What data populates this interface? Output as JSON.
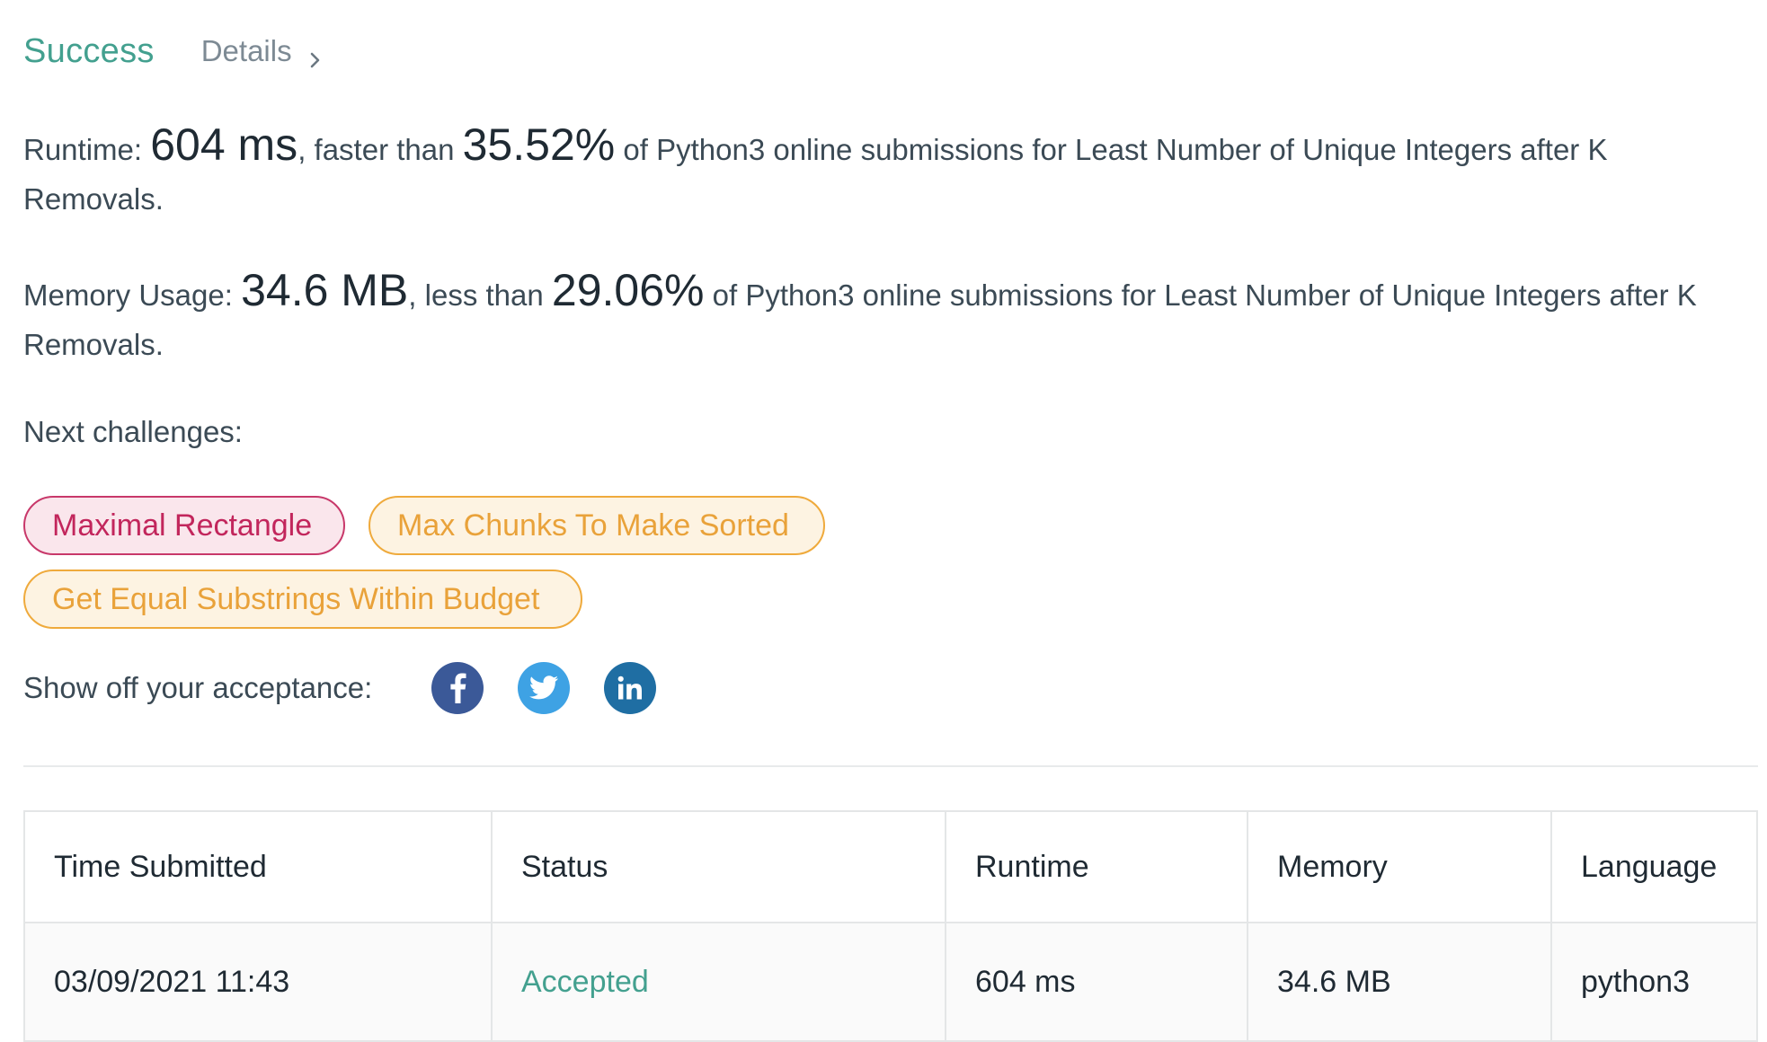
{
  "header": {
    "status_label": "Success",
    "details_label": "Details"
  },
  "runtime_stat": {
    "prefix": "Runtime: ",
    "value": "604 ms",
    "middle": ", faster than ",
    "percent": "35.52%",
    "suffix": " of Python3 online submissions for Least Number of Unique Integers after K Removals."
  },
  "memory_stat": {
    "prefix": "Memory Usage: ",
    "value": "34.6 MB",
    "middle": ", less than ",
    "percent": "29.06%",
    "suffix": " of Python3 online submissions for Least Number of Unique Integers after K Removals."
  },
  "next_challenges": {
    "label": "Next challenges:",
    "items": [
      {
        "title": "Maximal Rectangle",
        "difficulty": "hard",
        "color": "#c2265c"
      },
      {
        "title": "Max Chunks To Make Sorted",
        "difficulty": "medium",
        "color": "#e9a23a"
      },
      {
        "title": "Get Equal Substrings Within Budget",
        "difficulty": "medium",
        "color": "#e9a23a"
      }
    ]
  },
  "share": {
    "label": "Show off your acceptance:",
    "icons": [
      "facebook-icon",
      "twitter-icon",
      "linkedin-icon"
    ],
    "colors": {
      "facebook": "#3b5998",
      "twitter": "#3ea2e4",
      "linkedin": "#1f6ea3"
    }
  },
  "submissions_table": {
    "columns": [
      "Time Submitted",
      "Status",
      "Runtime",
      "Memory",
      "Language"
    ],
    "rows": [
      {
        "time_submitted": "03/09/2021 11:43",
        "status": "Accepted",
        "runtime": "604 ms",
        "memory": "34.6 MB",
        "language": "python3"
      }
    ]
  },
  "colors": {
    "success": "#43a08f",
    "accepted": "#43a08f",
    "text": "#3b4a55"
  }
}
